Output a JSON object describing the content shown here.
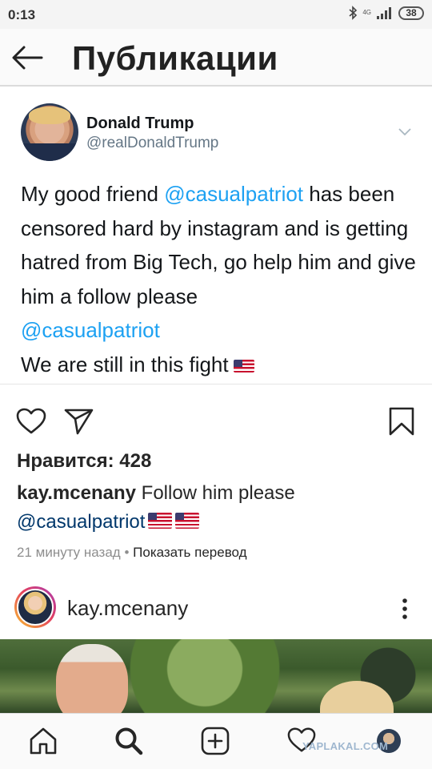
{
  "status_bar": {
    "time": "0:13",
    "network": "4G",
    "battery": "38"
  },
  "header": {
    "back_icon": "arrow-left-icon",
    "title": "Публикации"
  },
  "post": {
    "author_name": "Donald Trump",
    "author_handle": "@realDonaldTrump",
    "text": {
      "line1_pre": "My good friend ",
      "mention1": "@casualpatriot",
      "line1_post": " has been censored hard by instagram and is getting hatred from Big Tech, go help him and give him a follow please",
      "mention2": "@casualpatriot",
      "line_last": "We are still in this fight"
    },
    "colors": {
      "mention": "#1da1f2",
      "text": "#14171a",
      "handle": "#657786"
    }
  },
  "actions": {
    "like_icon": "heart-icon",
    "share_icon": "send-icon",
    "save_icon": "bookmark-icon"
  },
  "likes": "Нравится: 428",
  "comment": {
    "user": "kay.mcenany",
    "text": " Follow him please",
    "mention": "@casualpatriot"
  },
  "meta": {
    "time_ago": "21 минуту назад",
    "separator": " • ",
    "translate": "Показать перевод"
  },
  "second_post": {
    "user": "kay.mcenany",
    "more_icon": "more-vertical-icon"
  },
  "bottom_nav": {
    "items": [
      "home-icon",
      "search-icon",
      "add-post-icon",
      "heart-icon",
      "profile-avatar"
    ],
    "watermark": "YAPLAKAL.COM"
  }
}
